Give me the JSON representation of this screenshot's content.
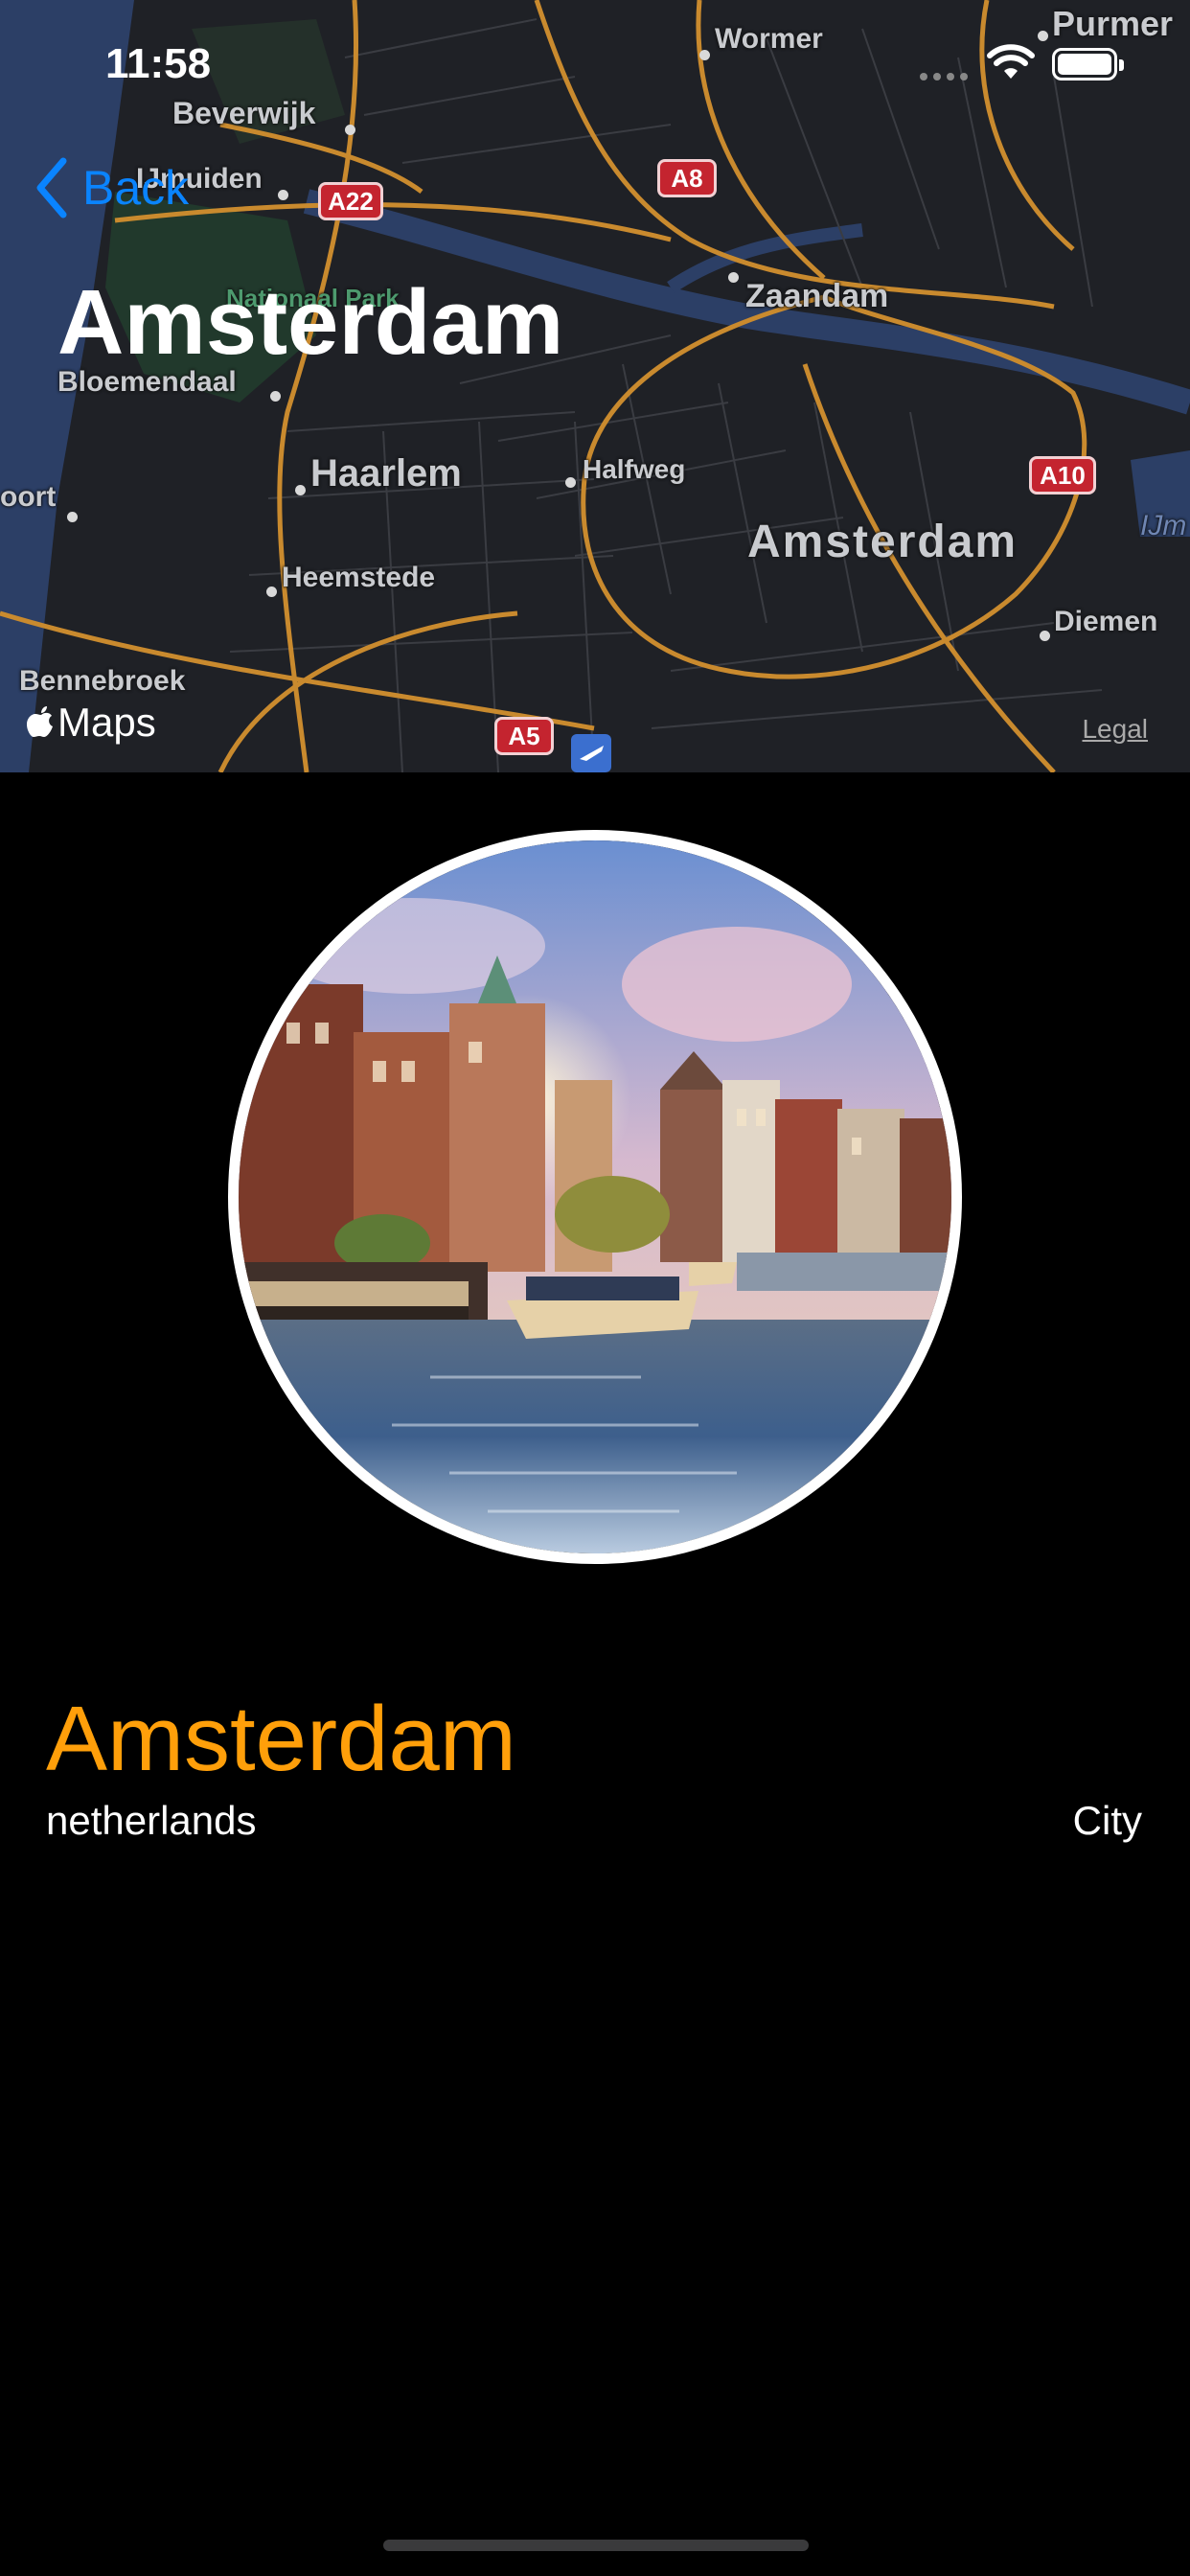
{
  "status_bar": {
    "time": "11:58"
  },
  "nav": {
    "back_label": "Back",
    "title": "Amsterdam"
  },
  "map": {
    "attribution": "Maps",
    "legal": "Legal",
    "labels": {
      "purmer": "Purmer",
      "wormer": "Wormer",
      "beverwijk": "Beverwijk",
      "ijmuiden": "IJmuiden",
      "national_park": "Nationaal Park",
      "zaandam": "Zaandam",
      "bloemendaal": "Bloemendaal",
      "haarlem": "Haarlem",
      "halfweg": "Halfweg",
      "amsterdam": "Amsterdam",
      "oort": "oort",
      "heemstede": "Heemstede",
      "diemen": "Diemen",
      "bennebroek": "Bennebroek",
      "ijm": "IJm"
    },
    "shields": {
      "a22": "A22",
      "a8": "A8",
      "a10": "A10",
      "a5": "A5"
    },
    "colors": {
      "water": "#2c3f66",
      "road": "#c98a2e",
      "land": "#1f2126",
      "park": "#21392c"
    }
  },
  "detail": {
    "name": "Amsterdam",
    "country": "netherlands",
    "type": "City",
    "accent_color": "#ff9f0a"
  }
}
